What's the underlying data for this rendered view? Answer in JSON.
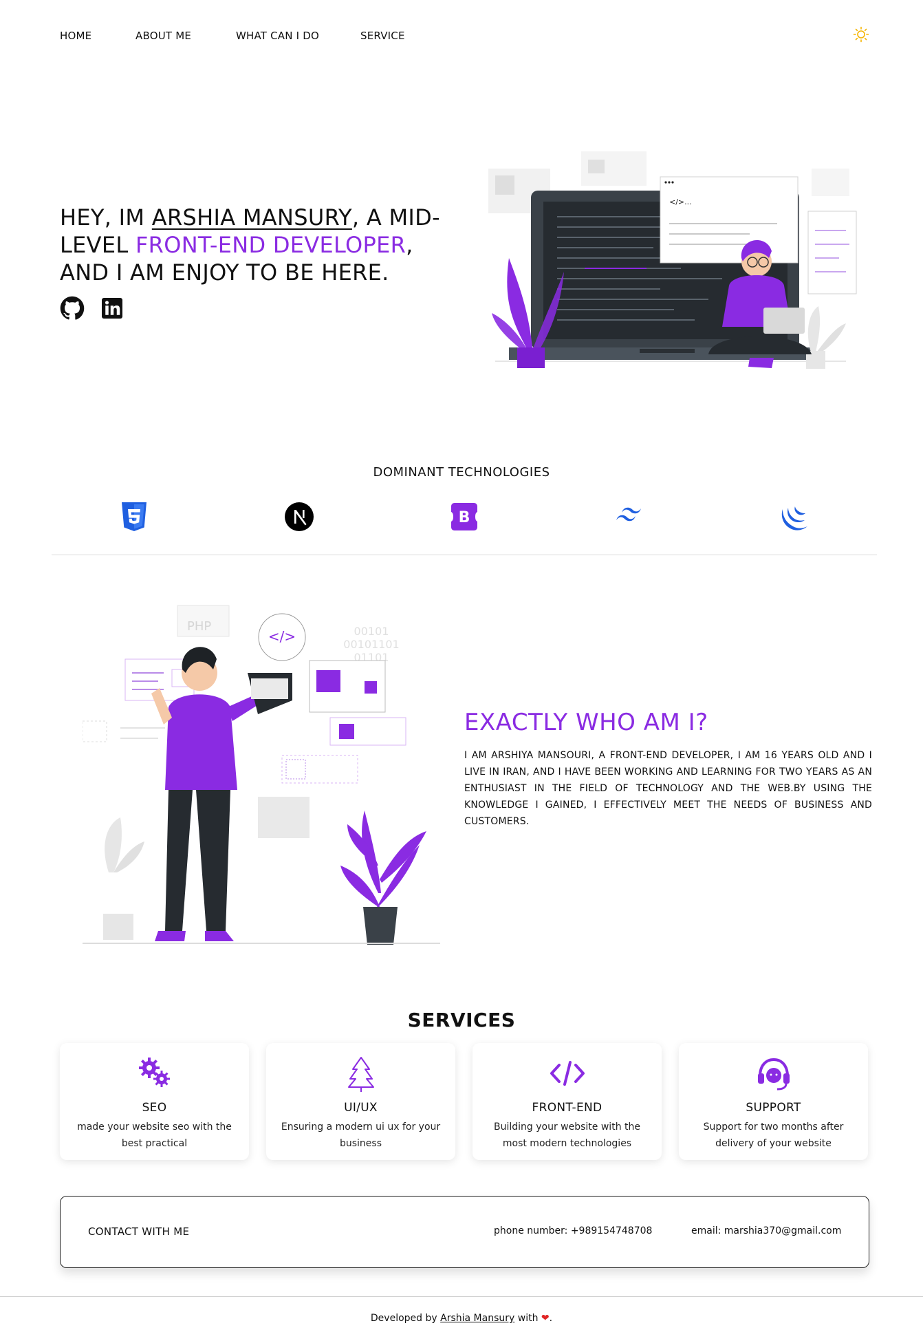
{
  "nav": {
    "items": [
      {
        "label": "HOME"
      },
      {
        "label": "ABOUT ME"
      },
      {
        "label": "WHAT CAN I DO"
      },
      {
        "label": "SERVICE"
      }
    ],
    "theme_icon": "sun-icon"
  },
  "hero": {
    "line_prefix": "HEY, IM ",
    "name": "ARSHIA MANSURY",
    "mid": ", A MID-LEVEL ",
    "accent": "FRONT-END DEVELOPER",
    "suffix": ", AND I AM ENJOY TO BE HERE.",
    "socials": [
      {
        "icon": "github-icon"
      },
      {
        "icon": "linkedin-icon"
      }
    ]
  },
  "technologies": {
    "heading": "DOMINANT TECHNOLOGIES",
    "icons": [
      "css3-icon",
      "nextjs-icon",
      "bootstrap-icon",
      "tailwind-icon",
      "jquery-icon"
    ]
  },
  "about": {
    "title": "EXACTLY WHO AM I?",
    "text": "I AM ARSHIYA MANSOURI, A FRONT-END DEVELOPER, I AM 16 YEARS OLD AND I LIVE IN IRAN, AND I HAVE BEEN WORKING AND LEARNING FOR TWO YEARS AS AN ENTHUSIAST IN THE FIELD OF TECHNOLOGY AND THE WEB.BY USING THE KNOWLEDGE I GAINED, I EFFECTIVELY MEET THE NEEDS OF BUSINESS AND CUSTOMERS."
  },
  "services": {
    "title": "SERVICES",
    "items": [
      {
        "icon": "gears-icon",
        "name": "SEO",
        "desc": "made your website seo with the best practical"
      },
      {
        "icon": "tree-icon",
        "name": "UI/UX",
        "desc": "Ensuring a modern ui ux for your business"
      },
      {
        "icon": "code-icon",
        "name": "FRONT-END",
        "desc": "Building your website with the most modern technologies"
      },
      {
        "icon": "headset-icon",
        "name": "SUPPORT",
        "desc": "Support for two months after delivery of your website"
      }
    ]
  },
  "contact": {
    "title": "CONTACT WITH ME",
    "phone": "phone number: +989154748708",
    "email": "email: marshia370@gmail.com"
  },
  "footer": {
    "prefix": "Developed by ",
    "name": "Arshia Mansury",
    "with": " with ",
    "end": "."
  },
  "colors": {
    "accent": "#8a2be2",
    "theme_icon": "#f5b400",
    "heart": "#e02424"
  }
}
